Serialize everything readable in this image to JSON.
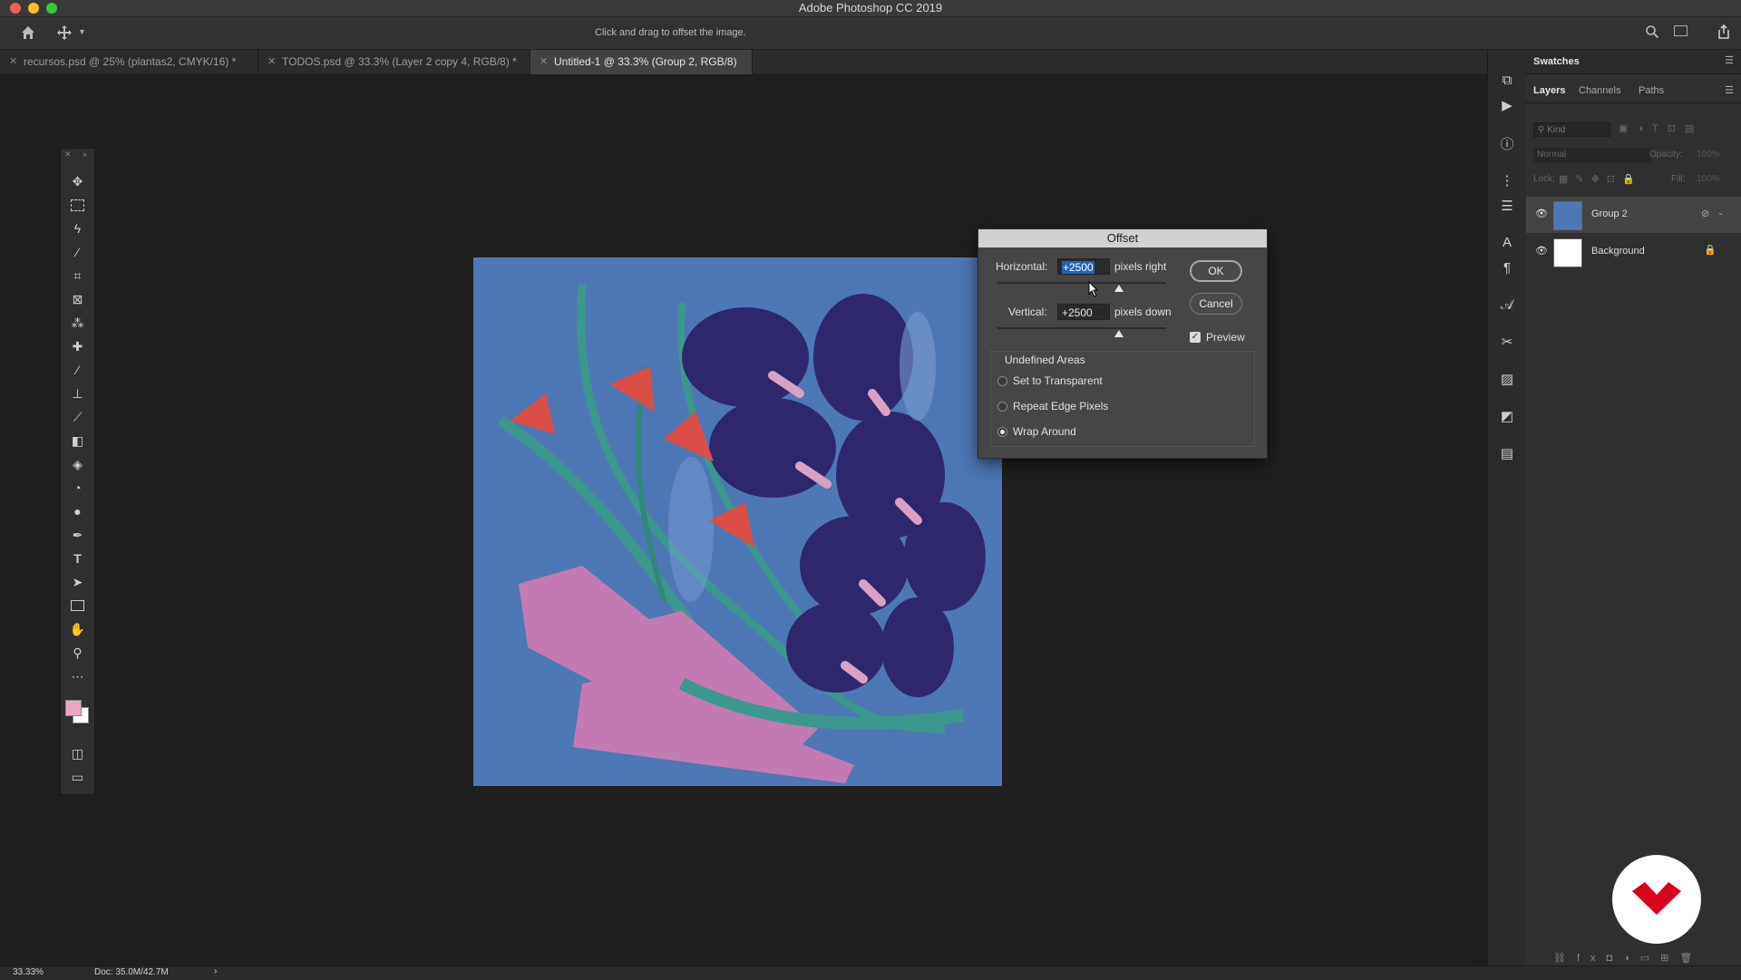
{
  "app": {
    "title": "Adobe Photoshop CC 2019"
  },
  "options_bar": {
    "hint": "Click and drag to offset the image."
  },
  "tabs": [
    {
      "label": "recursos.psd @ 25% (plantas2, CMYK/16) *",
      "active": false
    },
    {
      "label": "TODOS.psd @ 33.3% (Layer 2 copy 4, RGB/8) *",
      "active": false
    },
    {
      "label": "Untitled-1 @ 33.3% (Group 2, RGB/8) *",
      "active": true
    }
  ],
  "toolbar": {
    "tools": [
      "move-tool",
      "marquee-tool",
      "lasso-tool",
      "magic-wand-tool",
      "crop-tool",
      "frame-tool",
      "eyedropper-tool",
      "healing-tool",
      "brush-tool",
      "stamp-tool",
      "history-brush-tool",
      "eraser-tool",
      "paint-bucket-tool",
      "blur-tool",
      "dodge-tool",
      "pen-tool",
      "type-tool",
      "path-select-tool",
      "rectangle-tool",
      "hand-tool",
      "zoom-tool",
      "more-tools"
    ],
    "foreground_color": "#e9a6c6",
    "background_color": "#ffffff"
  },
  "dialog": {
    "title": "Offset",
    "horizontal_label": "Horizontal:",
    "horizontal_value": "+2500",
    "horizontal_unit": "pixels right",
    "horizontal_slider": 0.72,
    "vertical_label": "Vertical:",
    "vertical_value": "+2500",
    "vertical_unit": "pixels down",
    "vertical_slider": 0.72,
    "ok_label": "OK",
    "cancel_label": "Cancel",
    "preview_label": "Preview",
    "preview_checked": true,
    "undefined_areas_label": "Undefined Areas",
    "options": [
      {
        "label": "Set to Transparent",
        "selected": false
      },
      {
        "label": "Repeat Edge Pixels",
        "selected": false
      },
      {
        "label": "Wrap Around",
        "selected": true
      }
    ]
  },
  "panels": {
    "top_tab": "Swatches",
    "tabs": [
      "Layers",
      "Channels",
      "Paths"
    ],
    "active_tab": "Layers",
    "filter_placeholder": "Kind",
    "blend_mode": "Normal",
    "opacity_label": "Opacity:",
    "opacity_value": "100%",
    "lock_label": "Lock:",
    "fill_label": "Fill:",
    "fill_value": "100%",
    "layers": [
      {
        "name": "Group 2",
        "selected": true
      },
      {
        "name": "Background",
        "selected": false,
        "locked": true
      }
    ]
  },
  "status": {
    "zoom": "33.33%",
    "doc": "Doc: 35.0M/42.7M"
  },
  "colors": {
    "artwork_bg": "#4e77b5",
    "accent": "#2463b8"
  }
}
